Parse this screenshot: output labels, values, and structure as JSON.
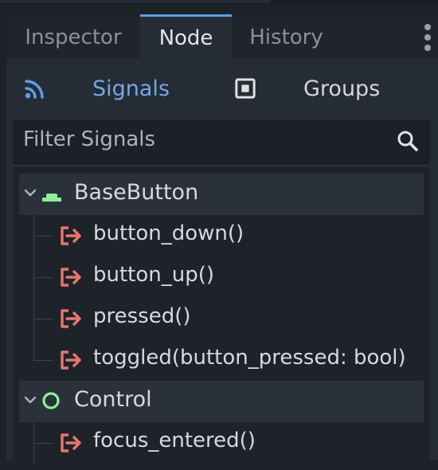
{
  "tabs": [
    {
      "label": "Inspector",
      "active": false
    },
    {
      "label": "Node",
      "active": true
    },
    {
      "label": "History",
      "active": false
    }
  ],
  "modes": {
    "signals_label": "Signals",
    "signals_icon": "signals-icon",
    "groups_label": "Groups",
    "groups_icon": "groups-icon"
  },
  "filter": {
    "placeholder": "Filter Signals",
    "icon": "search-icon"
  },
  "tree": {
    "groups": [
      {
        "name": "BaseButton",
        "icon": "base-button-icon",
        "signals": [
          "button_down()",
          "button_up()",
          "pressed()",
          "toggled(button_pressed: bool)"
        ]
      },
      {
        "name": "Control",
        "icon": "control-icon",
        "signals": [
          "focus_entered()"
        ]
      }
    ]
  },
  "colors": {
    "accent": "#5aa0e8",
    "signal_icon": "#e8776a",
    "class_icon": "#8eef97"
  }
}
